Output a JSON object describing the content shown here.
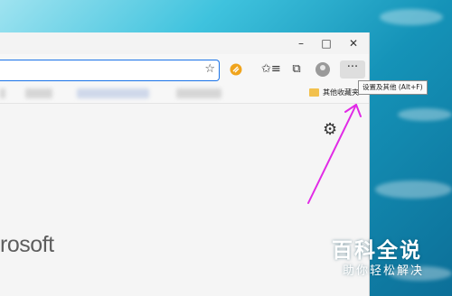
{
  "window": {
    "minimize": "–",
    "maximize": "□",
    "close": "✕"
  },
  "toolbar": {
    "favorite_star": "☆",
    "collections_icon": "✩≡",
    "tabs_icon": "⧉",
    "more_label": "···"
  },
  "favorites_bar": {
    "other_favorites_label": "其他收藏夹"
  },
  "tooltip": {
    "text": "设置及其他 (Alt+F)"
  },
  "content": {
    "brand_partial": "rosoft",
    "gear_icon": "⚙"
  },
  "watermark": {
    "title": "百科全说",
    "subtitle": "助你轻松解决"
  },
  "colors": {
    "arrow": "#e12ae6",
    "accent": "#1a73e8",
    "extension_icon": "#f0a41c"
  }
}
